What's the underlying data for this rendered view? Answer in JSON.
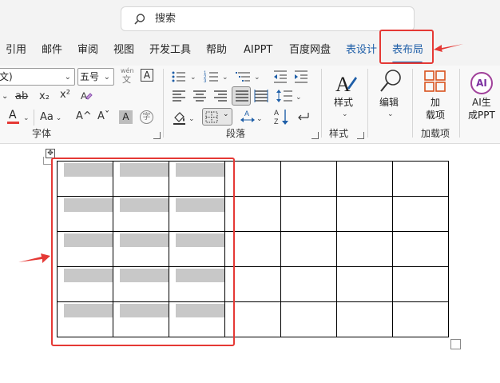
{
  "search": {
    "placeholder": "搜索"
  },
  "tabs": {
    "items": [
      {
        "label": "引用"
      },
      {
        "label": "邮件"
      },
      {
        "label": "审阅"
      },
      {
        "label": "视图"
      },
      {
        "label": "开发工具"
      },
      {
        "label": "帮助"
      },
      {
        "label": "AIPPT"
      },
      {
        "label": "百度网盘"
      },
      {
        "label": "表设计"
      },
      {
        "label": "表布局"
      }
    ],
    "active": "表布局"
  },
  "ribbon": {
    "font": {
      "font_name_partial": "文)",
      "font_size": "五号",
      "pinyin_top": "wén",
      "pinyin_bottom": "文",
      "border_char": "A",
      "strike_label": "ab",
      "sub_label": "x₂",
      "sup_label": "x²",
      "font_color_label": "A",
      "grow_label": "A^",
      "shrink_label": "Aˇ",
      "case_label": "Aa",
      "shade_char_label": "A",
      "phonetic_circle": "字",
      "group_label": "字体"
    },
    "paragraph": {
      "group_label": "段落"
    },
    "styles": {
      "button_label": "样式",
      "group_label": "样式"
    },
    "edit": {
      "button_label": "编辑"
    },
    "addins": {
      "button_label_1": "加",
      "button_label_2": "载项",
      "group_label": "加载项"
    },
    "ai": {
      "icon_text": "AI",
      "button_label_1": "AI生",
      "button_label_2": "成PPT"
    }
  },
  "table": {
    "rows": 5,
    "cols": 7,
    "shaded_cols": 3
  },
  "colors": {
    "accent": "#1f5fa8",
    "highlight_red": "#e53935",
    "shade_gray": "#c8c8c8",
    "font_red": "#e53935"
  }
}
